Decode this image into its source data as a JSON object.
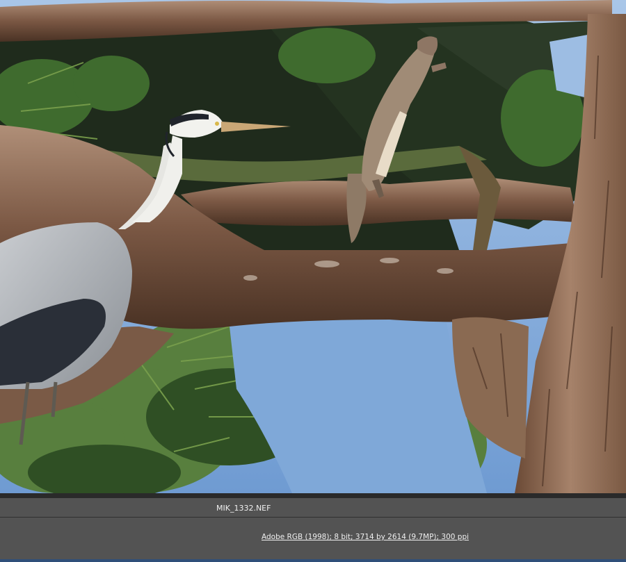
{
  "file": {
    "name": "MIK_1332.NEF"
  },
  "document_info": {
    "text": "Adobe RGB (1998); 8 bit; 3714 by 2614 (9.7MP); 300 ppi"
  },
  "colors": {
    "sky": "#7fa8d8",
    "panel": "#535353",
    "separator": "#2a2a2a",
    "accent": "#2f4f79"
  }
}
